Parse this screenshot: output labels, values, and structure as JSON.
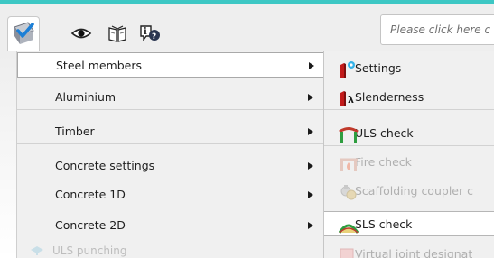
{
  "toolbar": {
    "active_tab": "check-icon",
    "buttons": [
      "eye-icon",
      "book-icon",
      "info-help-icon"
    ],
    "command_placeholder": "Please click here c"
  },
  "main_menu": {
    "items": [
      {
        "label": "Steel members",
        "submenu": true
      },
      {
        "label": "Aluminium",
        "submenu": true
      },
      {
        "label": "Timber",
        "submenu": true
      },
      {
        "label": "Concrete settings",
        "submenu": true
      },
      {
        "label": "Concrete 1D",
        "submenu": true
      },
      {
        "label": "Concrete 2D",
        "submenu": true
      },
      {
        "label": "ULS punching",
        "enabled": false
      }
    ]
  },
  "steel_submenu": {
    "items": [
      {
        "label": "Settings",
        "icon": "steel-settings-icon",
        "enabled": true
      },
      {
        "label": "Slenderness",
        "icon": "slenderness-icon",
        "enabled": true
      },
      {
        "label": "ULS check",
        "icon": "uls-frame-icon",
        "enabled": true
      },
      {
        "label": "Fire check",
        "icon": "fire-check-icon",
        "enabled": false
      },
      {
        "label": "Scaffolding coupler c",
        "icon": "scaffolding-coupler-icon",
        "enabled": false
      },
      {
        "label": "SLS check",
        "icon": "sls-deflection-icon",
        "enabled": true
      },
      {
        "label": "Virtual joint designat",
        "icon": "virtual-joint-icon",
        "enabled": false
      }
    ]
  },
  "colors": {
    "accent_top_line": "#3dc7c4",
    "selected_bg": "#ffffff",
    "disabled_text": "#b0b0b0"
  }
}
